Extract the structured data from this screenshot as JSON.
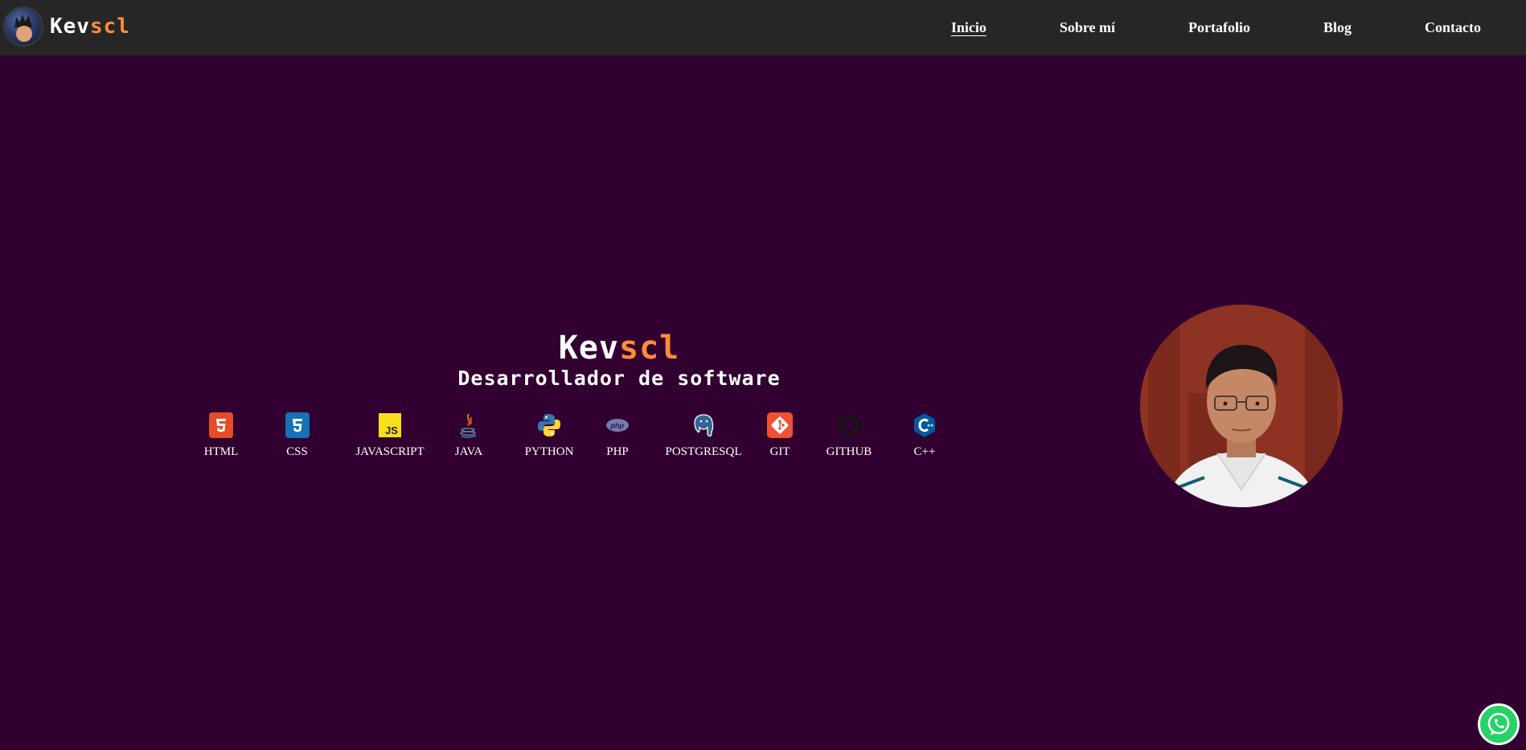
{
  "brand": {
    "name_prefix": "Kev",
    "name_suffix": "scl"
  },
  "nav": {
    "items": [
      {
        "label": "Inicio",
        "active": true
      },
      {
        "label": "Sobre mí",
        "active": false
      },
      {
        "label": "Portafolio",
        "active": false
      },
      {
        "label": "Blog",
        "active": false
      },
      {
        "label": "Contacto",
        "active": false
      }
    ]
  },
  "hero": {
    "name_prefix": "Kev",
    "name_suffix": "scl",
    "subtitle": "Desarrollador de software"
  },
  "skills": [
    {
      "label": "HTML",
      "icon": "html5-icon"
    },
    {
      "label": "CSS",
      "icon": "css3-icon"
    },
    {
      "label": "JAVASCRIPT",
      "icon": "javascript-icon"
    },
    {
      "label": "JAVA",
      "icon": "java-icon"
    },
    {
      "label": "PYTHON",
      "icon": "python-icon"
    },
    {
      "label": "PHP",
      "icon": "php-icon"
    },
    {
      "label": "POSTGRESQL",
      "icon": "postgresql-icon"
    },
    {
      "label": "GIT",
      "icon": "git-icon"
    },
    {
      "label": "GITHUB",
      "icon": "github-icon"
    },
    {
      "label": "C++",
      "icon": "cplusplus-icon"
    }
  ],
  "colors": {
    "background": "#310031",
    "header": "#262626",
    "accent": "#ff8c3a",
    "whatsapp": "#25d366"
  }
}
